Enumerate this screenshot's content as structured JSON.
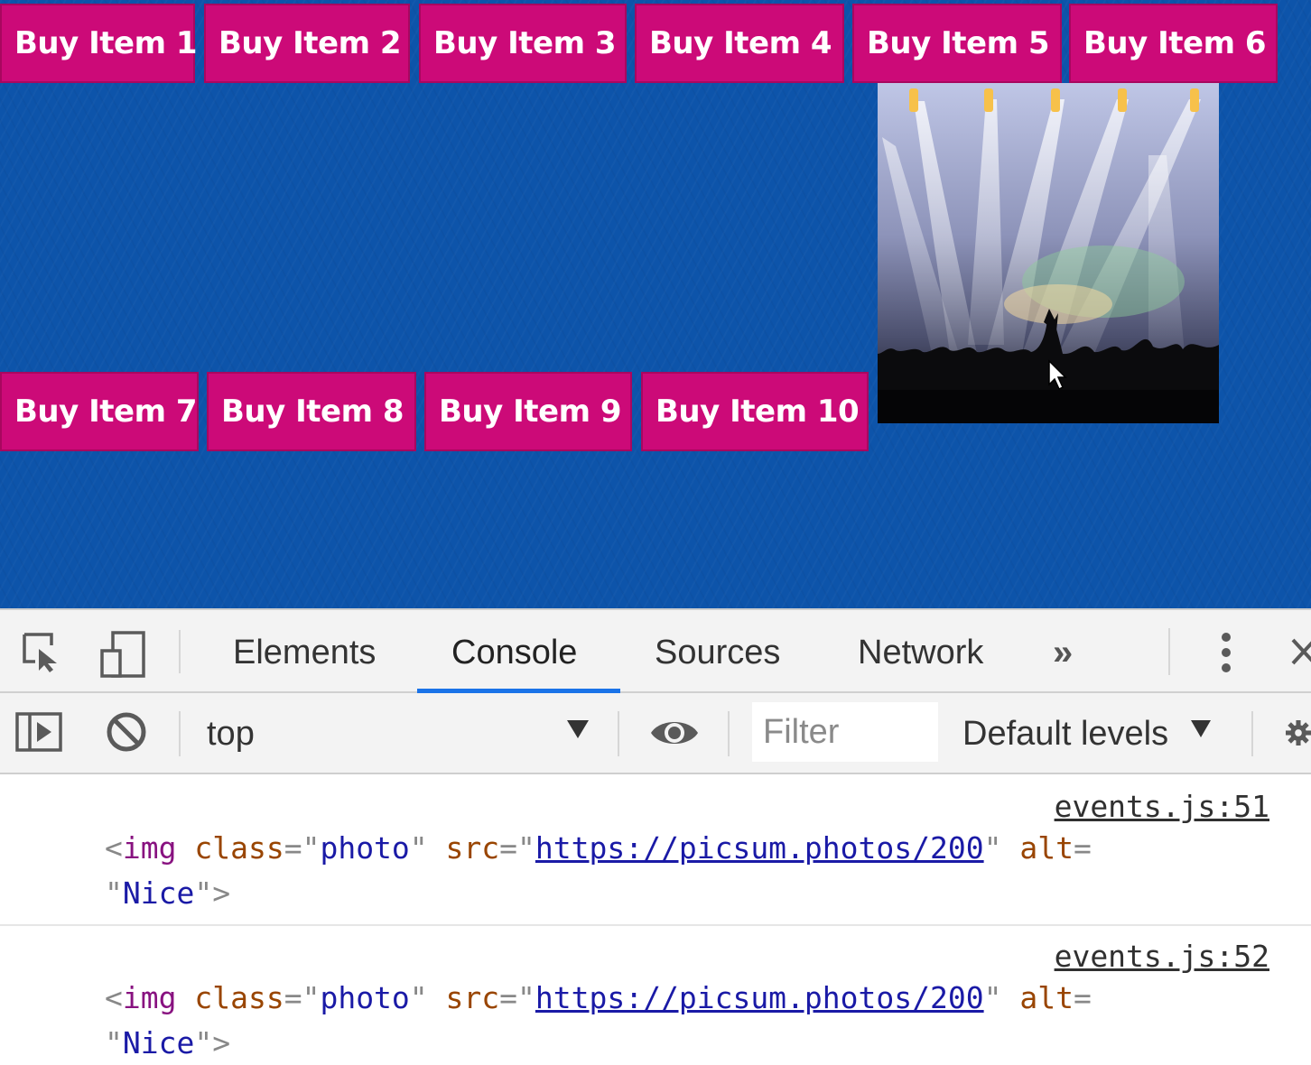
{
  "page": {
    "buttons_row1": [
      "Buy Item 1",
      "Buy Item 2",
      "Buy Item 3",
      "Buy Item 4",
      "Buy Item 5",
      "Buy Item 6"
    ],
    "buttons_row2": [
      "Buy Item 7",
      "Buy Item 8",
      "Buy Item 9",
      "Buy Item 10"
    ],
    "colors": {
      "background": "#0d54aa",
      "button": "#cc0a78"
    },
    "photo": {
      "subject": "concert-stage-lights"
    }
  },
  "devtools": {
    "tabs": [
      "Elements",
      "Console",
      "Sources",
      "Network"
    ],
    "active_tab": "Console",
    "more_tabs_glyph": "»",
    "icons": {
      "inspect": "inspect-element-icon",
      "device": "device-toolbar-icon",
      "menu": "kebab-menu-icon",
      "close": "close-icon",
      "sidebar": "show-sidebar-icon",
      "clear": "clear-console-icon",
      "eye": "live-expression-icon",
      "settings": "gear-icon"
    },
    "toolbar": {
      "context": "top",
      "filter_placeholder": "Filter",
      "levels": "Default levels"
    },
    "accent": "#1a73e8"
  },
  "console": {
    "messages": [
      {
        "source": "events.js:51",
        "open": "<",
        "tag": "img",
        "attr_class": "class",
        "eq": "=\"",
        "class_value": "photo",
        "q": "\"",
        "attr_src": "src",
        "src_value": "https://picsum.photos/200",
        "attr_alt": "alt",
        "eq2": "=",
        "alt_value": "Nice",
        "close": ">"
      },
      {
        "source": "events.js:52",
        "open": "<",
        "tag": "img",
        "attr_class": "class",
        "eq": "=\"",
        "class_value": "photo",
        "q": "\"",
        "attr_src": "src",
        "src_value": "https://picsum.photos/200",
        "attr_alt": "alt",
        "eq2": "=",
        "alt_value": "Nice",
        "close": ">"
      }
    ]
  }
}
